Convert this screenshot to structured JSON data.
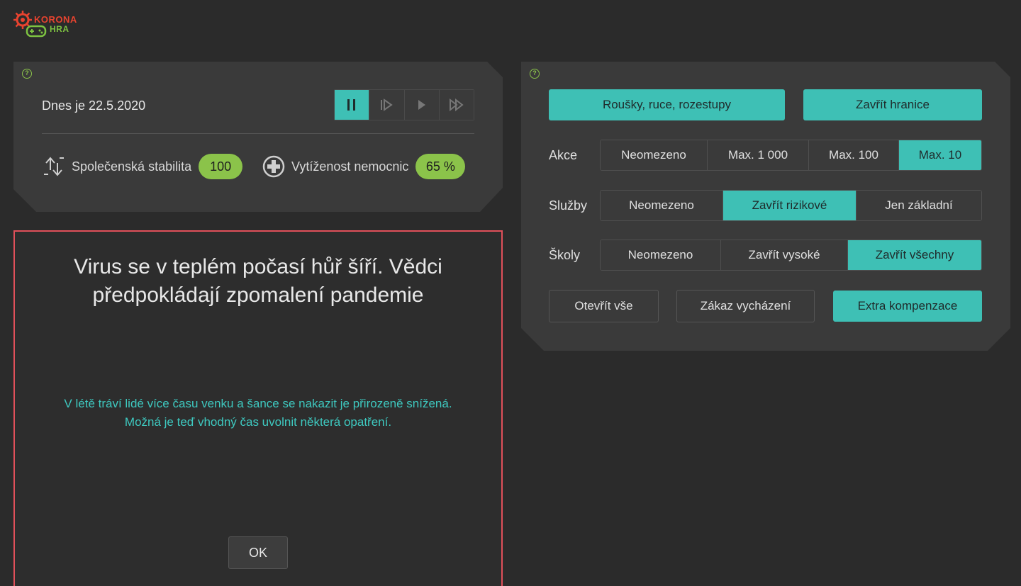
{
  "logo": {
    "line1": "KORONA",
    "line2": "HRA"
  },
  "status": {
    "date": "Dnes je 22.5.2020",
    "stability_label": "Společenská stabilita",
    "stability_value": "100",
    "hospital_label": "Vytíženost nemocnic",
    "hospital_value": "65 %",
    "controls": [
      "pause",
      "step",
      "play",
      "fast-forward"
    ],
    "active_control": "pause"
  },
  "measures": {
    "top_buttons": [
      {
        "label": "Roušky, ruce, rozestupy",
        "active": true
      },
      {
        "label": "Zavřít hranice",
        "active": true
      }
    ],
    "rows": [
      {
        "label": "Akce",
        "options": [
          "Neomezeno",
          "Max. 1 000",
          "Max. 100",
          "Max. 10"
        ],
        "selected": 3
      },
      {
        "label": "Služby",
        "options": [
          "Neomezeno",
          "Zavřít rizikové",
          "Jen základní"
        ],
        "selected": 1
      },
      {
        "label": "Školy",
        "options": [
          "Neomezeno",
          "Zavřít vysoké",
          "Zavřít všechny"
        ],
        "selected": 2
      }
    ],
    "bottom_buttons": [
      {
        "label": "Otevřít vše",
        "active": false
      },
      {
        "label": "Zákaz vycházení",
        "active": false
      },
      {
        "label": "Extra kompenzace",
        "active": true
      }
    ]
  },
  "news": {
    "title": "Virus se v teplém počasí hůř šíří. Vědci předpokládají zpomalení pandemie",
    "body_line1": "V létě tráví lidé více času venku a šance se nakazit je přirozeně snížená.",
    "body_line2": "Možná je teď vhodný čas uvolnit některá opatření.",
    "ok_label": "OK"
  },
  "colors": {
    "accent": "#3ec0b5",
    "good": "#8bc34a",
    "alert": "#e0505a",
    "logo_red": "#e8432f"
  }
}
